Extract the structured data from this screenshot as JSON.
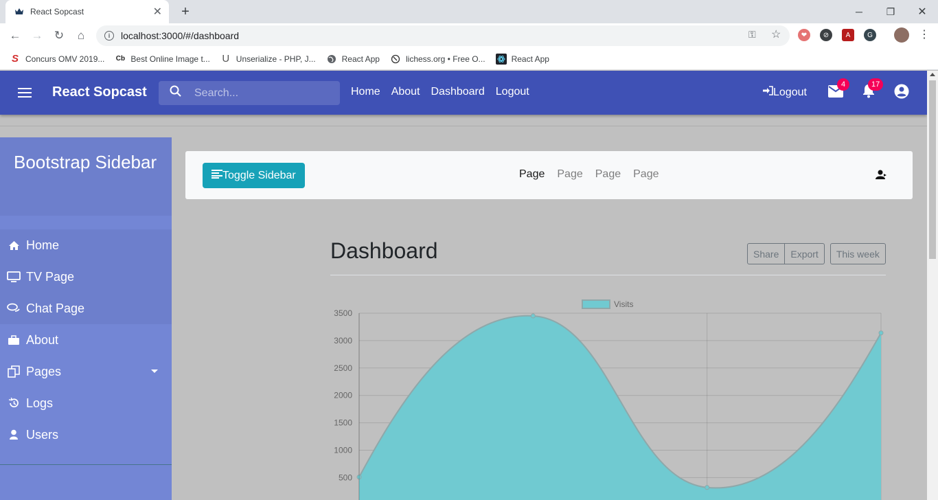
{
  "browser": {
    "tab_title": "React Sopcast",
    "url": "localhost:3000/#/dashboard",
    "bookmarks": [
      {
        "label": "Concurs OMV 2019...",
        "icon": "s-logo-icon"
      },
      {
        "label": "Best Online Image t...",
        "icon": "cb-icon"
      },
      {
        "label": "Unserialize - PHP, J...",
        "icon": "u-icon"
      },
      {
        "label": "React App",
        "icon": "globe-icon"
      },
      {
        "label": "lichess.org • Free O...",
        "icon": "lichess-icon"
      },
      {
        "label": "React App",
        "icon": "react-icon"
      }
    ]
  },
  "appbar": {
    "brand": "React Sopcast",
    "search_placeholder": "Search...",
    "nav": [
      "Home",
      "About",
      "Dashboard",
      "Logout"
    ],
    "logout_label": "Logout",
    "mail_count": "4",
    "notification_count": "17"
  },
  "sidebar": {
    "title": "Bootstrap Sidebar",
    "items": [
      {
        "label": "Home",
        "icon": "home-icon"
      },
      {
        "label": "TV Page",
        "icon": "tv-icon"
      },
      {
        "label": "Chat Page",
        "icon": "chat-icon"
      },
      {
        "label": "About",
        "icon": "briefcase-icon"
      },
      {
        "label": "Pages",
        "icon": "copy-icon"
      },
      {
        "label": "Logs",
        "icon": "history-icon"
      },
      {
        "label": "Users",
        "icon": "user-icon"
      }
    ]
  },
  "content_nav": {
    "toggle_label": "Toggle Sidebar",
    "pages": [
      "Page",
      "Page",
      "Page",
      "Page"
    ]
  },
  "dashboard": {
    "title": "Dashboard",
    "share_label": "Share",
    "export_label": "Export",
    "period_label": "This week"
  },
  "chart_data": {
    "type": "area",
    "series": [
      {
        "name": "Visits",
        "x": [
          0,
          1,
          2,
          3
        ],
        "values": [
          510,
          3450,
          320,
          3140
        ],
        "color": "#70cad1"
      }
    ],
    "yticks": [
      500,
      1000,
      1500,
      2000,
      2500,
      3000,
      3500
    ],
    "ylim": [
      0,
      3500
    ],
    "legend": "top-center",
    "grid": true
  }
}
